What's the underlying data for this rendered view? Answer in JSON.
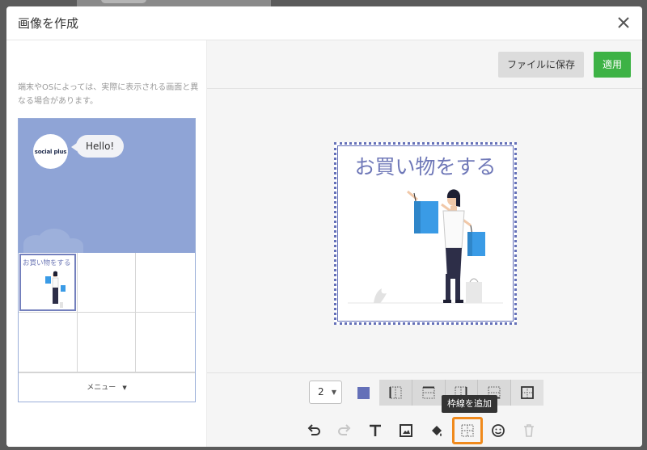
{
  "dialog": {
    "title": "画像を作成"
  },
  "preview": {
    "notice": "端末やOSによっては、実際に表示される画面と異なる場合があります。",
    "avatar_text": "social plus",
    "bubble_text": "Hello!",
    "thumb_text": "お買い物をする",
    "menu_label": "メニュー"
  },
  "actions": {
    "save_label": "ファイルに保存",
    "apply_label": "適用"
  },
  "canvas": {
    "title": "お買い物をする"
  },
  "toolbar": {
    "border_weight": "2",
    "border_color": "#6470b8",
    "tooltip": "枠線を追加",
    "border_options": [
      "border-left-icon",
      "border-top-icon",
      "border-right-icon",
      "border-bottom-icon",
      "border-all-icon"
    ],
    "tools": [
      "undo-icon",
      "redo-icon",
      "text-icon",
      "image-icon",
      "fill-icon",
      "border-icon",
      "emoji-icon",
      "trash-icon"
    ]
  },
  "colors": {
    "accent": "#6470b8",
    "apply": "#3db245",
    "highlight": "#f08a1c",
    "preview_bg": "#8fa4d6"
  }
}
